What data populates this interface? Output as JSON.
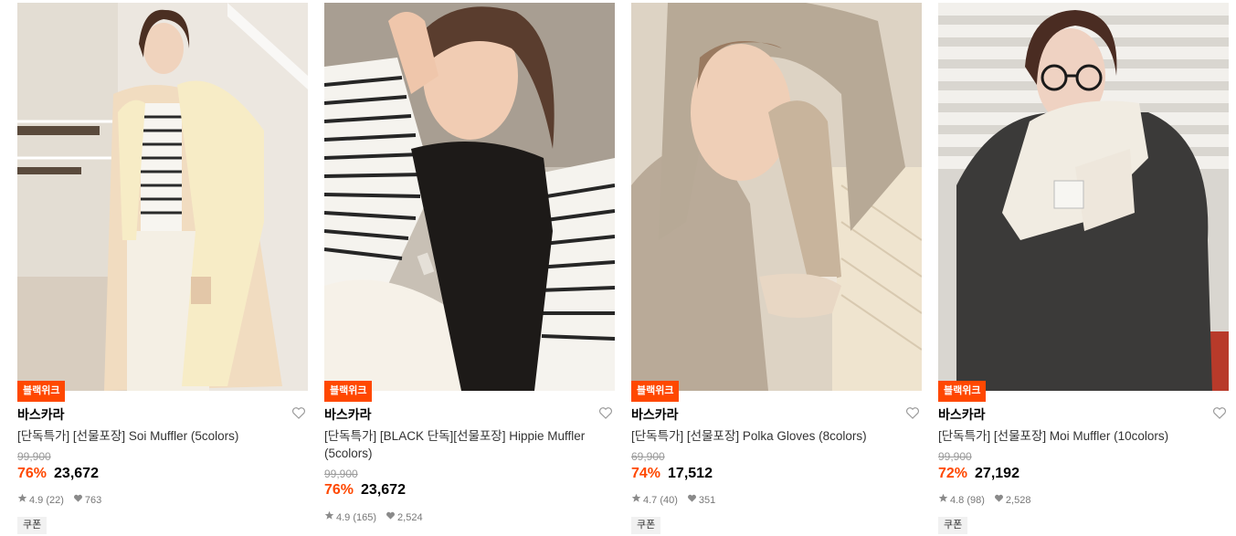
{
  "products": [
    {
      "badge": "블랙위크",
      "brand": "바스카라",
      "title": "[단독특가] [선물포장] Soi Muffler (5colors)",
      "original_price": "99,900",
      "discount": "76%",
      "price": "23,672",
      "rating": "4.9",
      "reviews": "(22)",
      "likes": "763",
      "coupon": "쿠폰",
      "image_alt": "Model in cream coat wearing cream fringed muffler"
    },
    {
      "badge": "블랙위크",
      "brand": "바스카라",
      "title": "[단독특가] [BLACK 단독][선물포장] Hippie Muffler (5colors)",
      "original_price": "99,900",
      "discount": "76%",
      "price": "23,672",
      "rating": "4.9",
      "reviews": "(165)",
      "likes": "2,524",
      "coupon": "",
      "image_alt": "Model in striped top wearing black muffler"
    },
    {
      "badge": "블랙위크",
      "brand": "바스카라",
      "title": "[단독특가] [선물포장] Polka Gloves (8colors)",
      "original_price": "69,900",
      "discount": "74%",
      "price": "17,512",
      "rating": "4.7",
      "reviews": "(40)",
      "likes": "351",
      "coupon": "쿠폰",
      "image_alt": "Model in beige boucle hood and gloves"
    },
    {
      "badge": "블랙위크",
      "brand": "바스카라",
      "title": "[단독특가] [선물포장] Moi Muffler (10colors)",
      "original_price": "99,900",
      "discount": "72%",
      "price": "27,192",
      "rating": "4.8",
      "reviews": "(98)",
      "likes": "2,528",
      "coupon": "쿠폰",
      "image_alt": "Model with glasses in dark coat wearing ivory muffler"
    }
  ],
  "colors": {
    "accent": "#ff4800",
    "strike": "#9a9a9a",
    "meta": "#777777"
  },
  "icons": {
    "wishlist": "heart-outline-icon",
    "rating": "star-icon",
    "likes": "heart-filled-icon"
  }
}
